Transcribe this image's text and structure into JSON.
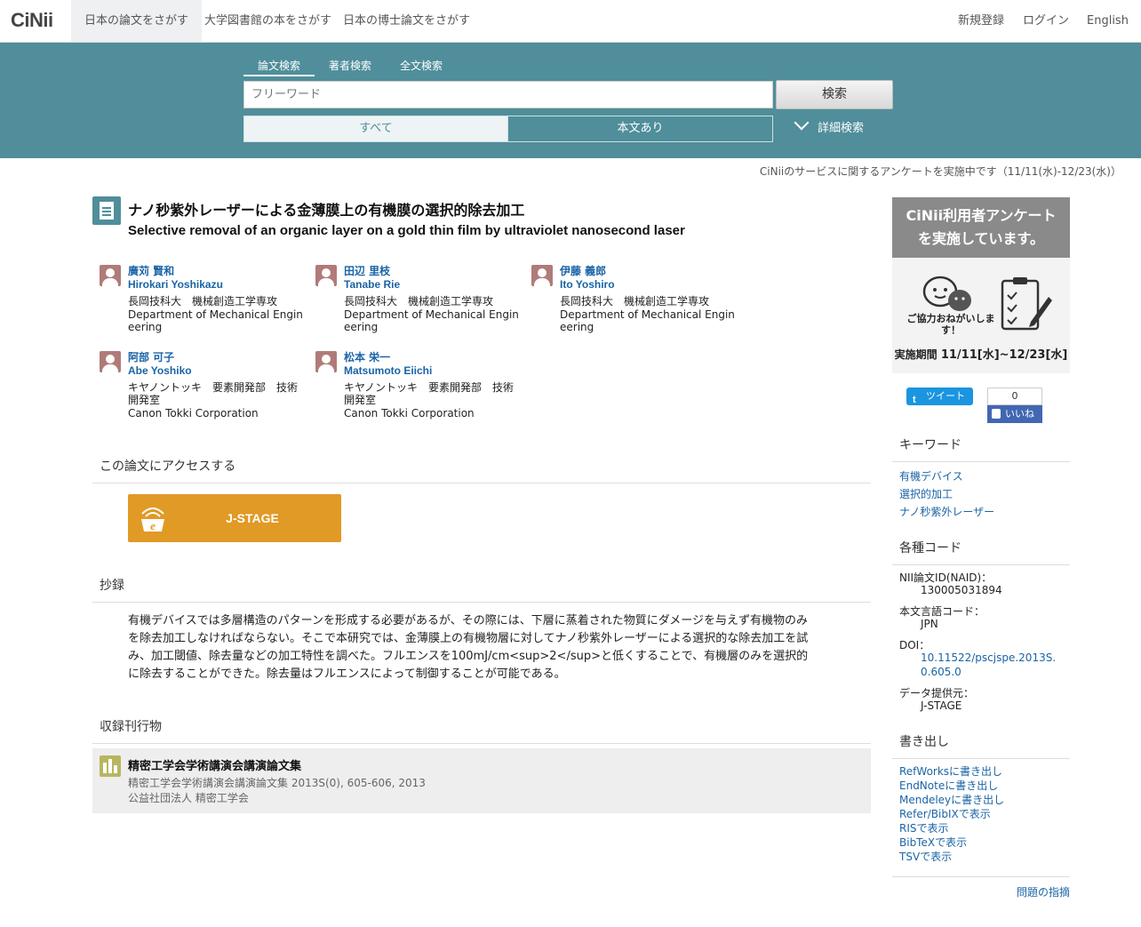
{
  "header": {
    "logo": "CiNii",
    "tabs": [
      "日本の論文をさがす",
      "大学図書館の本をさがす",
      "日本の博士論文をさがす"
    ],
    "right": [
      "新規登録",
      "ログイン",
      "English"
    ]
  },
  "search": {
    "tabs": [
      "論文検索",
      "著者検索",
      "全文検索"
    ],
    "placeholder": "フリーワード",
    "button": "検索",
    "filters": [
      "すべて",
      "本文あり"
    ],
    "advanced": "詳細検索"
  },
  "notice": "CiNiiのサービスに関するアンケートを実施中です（11/11(水)-12/23(水)）",
  "article": {
    "title_ja": "ナノ秒紫外レーザーによる金薄膜上の有機膜の選択的除去加工",
    "title_en": "Selective removal of an organic layer on a gold thin film by ultraviolet nanosecond laser"
  },
  "authors": [
    {
      "name_ja": "廣苅 賢和",
      "name_en": "Hirokari Yoshikazu",
      "aff_ja": "長岡技科大　機械創造工学専攻",
      "aff_en": "Department of Mechanical Engineering"
    },
    {
      "name_ja": "田辺 里枝",
      "name_en": "Tanabe Rie",
      "aff_ja": "長岡技科大　機械創造工学専攻",
      "aff_en": "Department of Mechanical Engineering"
    },
    {
      "name_ja": "伊藤 義郎",
      "name_en": "Ito Yoshiro",
      "aff_ja": "長岡技科大　機械創造工学専攻",
      "aff_en": "Department of Mechanical Engineering"
    },
    {
      "name_ja": "阿部 可子",
      "name_en": "Abe Yoshiko",
      "aff_ja": "キヤノントッキ　要素開発部　技術開発室",
      "aff_en": "Canon Tokki Corporation"
    },
    {
      "name_ja": "松本 栄一",
      "name_en": "Matsumoto Eiichi",
      "aff_ja": "キヤノントッキ　要素開発部　技術開発室",
      "aff_en": "Canon Tokki Corporation"
    }
  ],
  "access": {
    "heading": "この論文にアクセスする",
    "jstage_label": "J-STAGE"
  },
  "abstract": {
    "heading": "抄録",
    "text": "有機デバイスでは多層構造のパターンを形成する必要があるが、その際には、下層に蒸着された物質にダメージを与えず有機物のみを除去加工しなければならない。そこで本研究では、金薄膜上の有機物層に対してナノ秒紫外レーザーによる選択的な除去加工を試み、加工閾値、除去量などの加工特性を調べた。フルエンスを100mJ/cm<sup>2</sup>と低くすることで、有機層のみを選択的に除去することができた。除去量はフルエンスによって制御することが可能である。"
  },
  "publication": {
    "heading": "収録刊行物",
    "title": "精密工学会学術講演会講演論文集",
    "detail": "精密工学会学術講演会講演論文集 2013S(0), 605-606, 2013",
    "publisher": "公益社団法人 精密工学会"
  },
  "sidebar": {
    "banner": {
      "line1": "CiNii利用者アンケート",
      "line2": "を実施しています。",
      "ask": "ご協力おねがいします！",
      "period_label": "実施期間",
      "period": "11/11[水]~12/23[水]"
    },
    "tweet": "ツイート",
    "fb_count": "0",
    "fb_like": "いいね",
    "keywords_heading": "キーワード",
    "keywords": [
      "有機デバイス",
      "選択的加工",
      "ナノ秒紫外レーザー"
    ],
    "codes_heading": "各種コード",
    "codes": [
      {
        "label": "NII論文ID(NAID)：",
        "value": "130005031894"
      },
      {
        "label": "本文言語コード：",
        "value": "JPN"
      },
      {
        "label": "DOI：",
        "value": "10.11522/pscjspe.2013S.0.605.0"
      },
      {
        "label": "データ提供元：",
        "value": "J-STAGE"
      }
    ],
    "export_heading": "書き出し",
    "exports": [
      "RefWorksに書き出し",
      "EndNoteに書き出し",
      "Mendeleyに書き出し",
      "Refer/BibIXで表示",
      "RISで表示",
      "BibTeXで表示",
      "TSVで表示"
    ],
    "report": "問題の指摘"
  }
}
